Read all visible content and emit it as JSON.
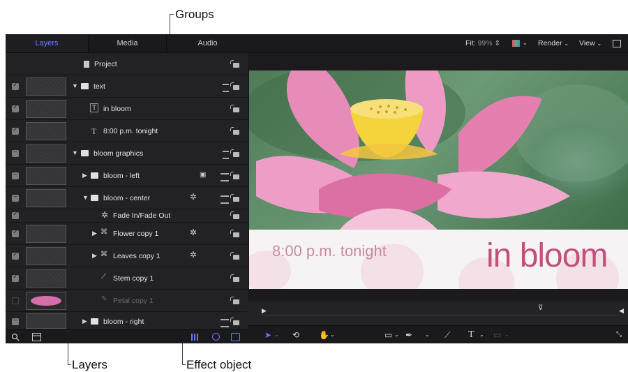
{
  "callouts": {
    "groups": "Groups",
    "layers": "Layers",
    "effect_object": "Effect object"
  },
  "tabs": [
    "Layers",
    "Media",
    "Audio"
  ],
  "layer_rows": [
    {
      "label": "Project",
      "kind": "project",
      "checked": null,
      "thumb": false,
      "indent": 0,
      "triangle": ""
    },
    {
      "label": "text",
      "kind": "group",
      "checked": "check",
      "thumb": true,
      "indent": 0,
      "triangle": "down"
    },
    {
      "label": "in bloom",
      "kind": "text-layer",
      "checked": "check",
      "thumb": true,
      "indent": 1,
      "triangle": ""
    },
    {
      "label": "8:00 p.m. tonight",
      "kind": "text-layer",
      "checked": "check",
      "thumb": true,
      "indent": 1,
      "triangle": ""
    },
    {
      "label": "bloom graphics",
      "kind": "group",
      "checked": "dash",
      "thumb": true,
      "indent": 0,
      "triangle": "down"
    },
    {
      "label": "bloom - left",
      "kind": "subgroup",
      "checked": "dash",
      "thumb": true,
      "indent": 1,
      "triangle": "right"
    },
    {
      "label": "bloom - center",
      "kind": "subgroup",
      "checked": "dash",
      "thumb": true,
      "indent": 1,
      "triangle": "down"
    },
    {
      "label": "Fade In/Fade Out",
      "kind": "effect",
      "checked": "check",
      "thumb": false,
      "indent": 2,
      "triangle": ""
    },
    {
      "label": "Flower copy 1",
      "kind": "replicator",
      "checked": "check",
      "thumb": true,
      "indent": 2,
      "triangle": "right"
    },
    {
      "label": "Leaves copy 1",
      "kind": "replicator",
      "checked": "check",
      "thumb": true,
      "indent": 2,
      "triangle": "right"
    },
    {
      "label": "Stem copy 1",
      "kind": "shape",
      "checked": "check",
      "thumb": true,
      "indent": 2,
      "triangle": ""
    },
    {
      "label": "Petal copy 1",
      "kind": "shape-disabled",
      "checked": "empty",
      "thumb": true,
      "indent": 2,
      "triangle": ""
    },
    {
      "label": "bloom - right",
      "kind": "subgroup",
      "checked": "dash",
      "thumb": true,
      "indent": 1,
      "triangle": "right"
    }
  ],
  "topbar": {
    "fit_label": "Fit:",
    "fit_value": "99%",
    "render": "Render",
    "view": "View"
  },
  "canvas": {
    "time_text": "8:00 p.m. tonight",
    "title_text": "in bloom"
  },
  "icons": {
    "search": "search-icon",
    "layout": "layout-icon",
    "select": "select-arrow-icon",
    "transform": "transform-icon",
    "pan": "hand-icon",
    "shape": "rectangle-icon",
    "pen": "pen-icon",
    "paint": "paint-stroke-icon",
    "text": "text-tool-icon",
    "mask": "mask-icon"
  },
  "colors": {
    "accent": "#6b79ff",
    "bloom_pink": "#c3507a",
    "time_pink": "#c98aa1"
  }
}
